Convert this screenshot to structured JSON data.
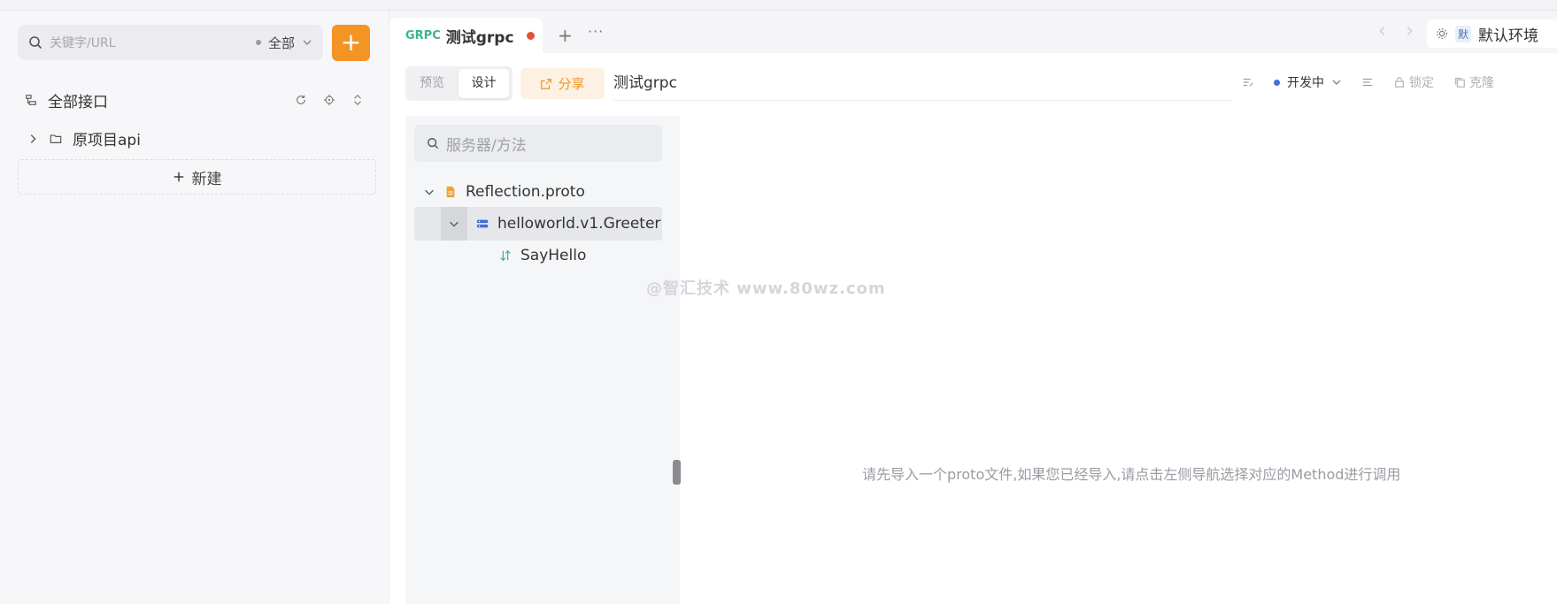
{
  "sidebar": {
    "search_placeholder": "关键字/URL",
    "scope": "全部",
    "add_label": "+",
    "all_label": "全部接口",
    "folder_label": "原项目api",
    "new_label": "新建"
  },
  "tabs": {
    "protocol": "GRPC",
    "name": "测试grpc",
    "plus": "+",
    "more": "···",
    "env_badge": "默",
    "env_label": "默认环境"
  },
  "toolbar": {
    "preview": "预览",
    "design": "设计",
    "share": "分享",
    "api_name": "测试grpc",
    "status": "开发中",
    "lock": "锁定",
    "clone": "克隆"
  },
  "panel": {
    "search_placeholder": "服务器/方法",
    "file": "Reflection.proto",
    "service": "helloworld.v1.Greeter",
    "method": "SayHello"
  },
  "hint": "请先导入一个proto文件,如果您已经导入,请点击左侧导航选择对应的Method进行调用",
  "watermark": "@智汇技术 www.80wz.com",
  "colors": {
    "accent": "#f29525",
    "grpc_green": "#3bb58d",
    "unsaved_dot": "#e2523b",
    "status_blue": "#3f6fd8"
  }
}
